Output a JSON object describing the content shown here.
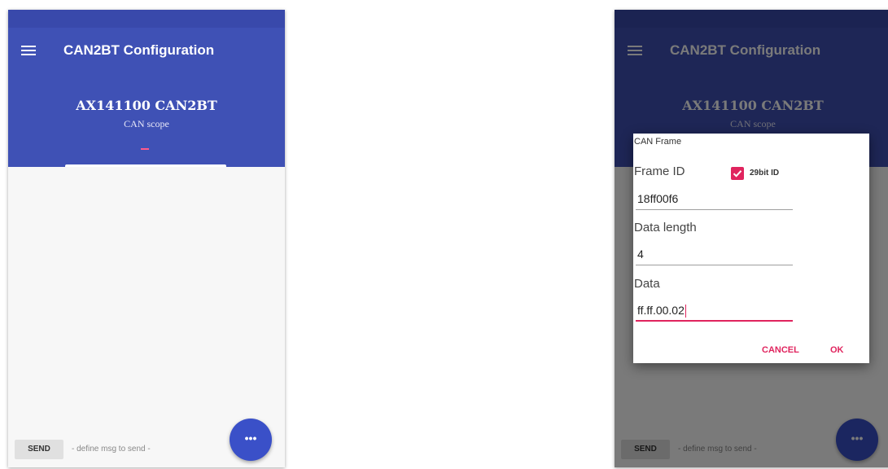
{
  "colors": {
    "primary": "#3f51b5",
    "primary_dark": "#3949ab",
    "accent": "#e0245e",
    "fab": "#3a50c8"
  },
  "icons": {
    "menu": "hamburger-menu-icon",
    "fab": "more-horiz-icon",
    "checkbox": "check-icon"
  },
  "app": {
    "title": "CAN2BT Configuration",
    "device_name": "AX141100 CAN2BT",
    "device_subtitle": "CAN scope"
  },
  "bottom_bar": {
    "send_label": "SEND",
    "hint": "- define msg to send -",
    "fab_label": "•••"
  },
  "dialog": {
    "title": "CAN Frame",
    "frame_id_label": "Frame ID",
    "checkbox_label": "29bit ID",
    "checkbox_checked": true,
    "frame_id_value": "18ff00f6",
    "data_length_label": "Data length",
    "data_length_value": "4",
    "data_label": "Data",
    "data_value": "ff.ff.00.02",
    "cancel_label": "CANCEL",
    "ok_label": "OK"
  }
}
